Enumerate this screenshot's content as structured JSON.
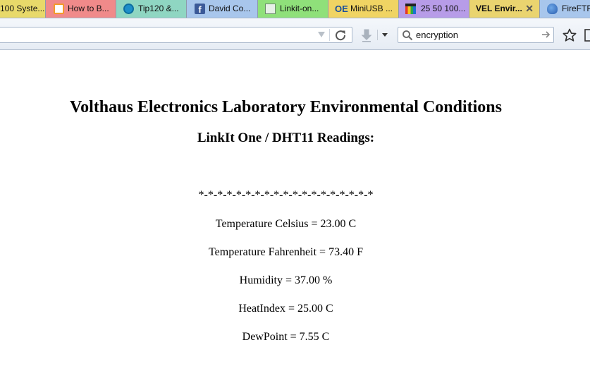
{
  "browser": {
    "tabs": [
      {
        "label": "100 Syste...",
        "active": false,
        "bg": "#e8d96a",
        "icon": "none"
      },
      {
        "label": "How to B...",
        "active": false,
        "bg": "#f08a8a",
        "icon": "instructables-icon"
      },
      {
        "label": "Tip120 &...",
        "active": false,
        "bg": "#8fd6c2",
        "icon": "circle-arrow-icon"
      },
      {
        "label": "David Co...",
        "active": false,
        "bg": "#a8c6ec",
        "icon": "facebook-icon"
      },
      {
        "label": "Linkit-on...",
        "active": false,
        "bg": "#8fe07a",
        "icon": "board-icon"
      },
      {
        "label": "MiniUSB ...",
        "active": false,
        "bg": "#f0d463",
        "icon": "oe-icon"
      },
      {
        "label": "25 50 100...",
        "active": false,
        "bg": "#b79ce8",
        "icon": "store-icon"
      },
      {
        "label": "VEL Envir...",
        "active": true,
        "bg": "#ead46f",
        "icon": "none"
      },
      {
        "label": "FireFTP",
        "active": false,
        "bg": "#a8c6ec",
        "icon": "fireftp-icon"
      }
    ],
    "close_glyph": "✕",
    "search_value": "encryption"
  },
  "page": {
    "title": "Volthaus Electronics Laboratory Environmental Conditions",
    "subtitle": "LinkIt One / DHT11 Readings:",
    "separator": "*-*-*-*-*-*-*-*-*-*-*-*-*-*-*-*-*-*-*",
    "readings": [
      "Temperature Celsius = 23.00 C",
      "Temperature Fahrenheit = 73.40 F",
      "Humidity = 37.00 %",
      "HeatIndex = 25.00 C",
      "DewPoint = 7.55 C"
    ]
  }
}
